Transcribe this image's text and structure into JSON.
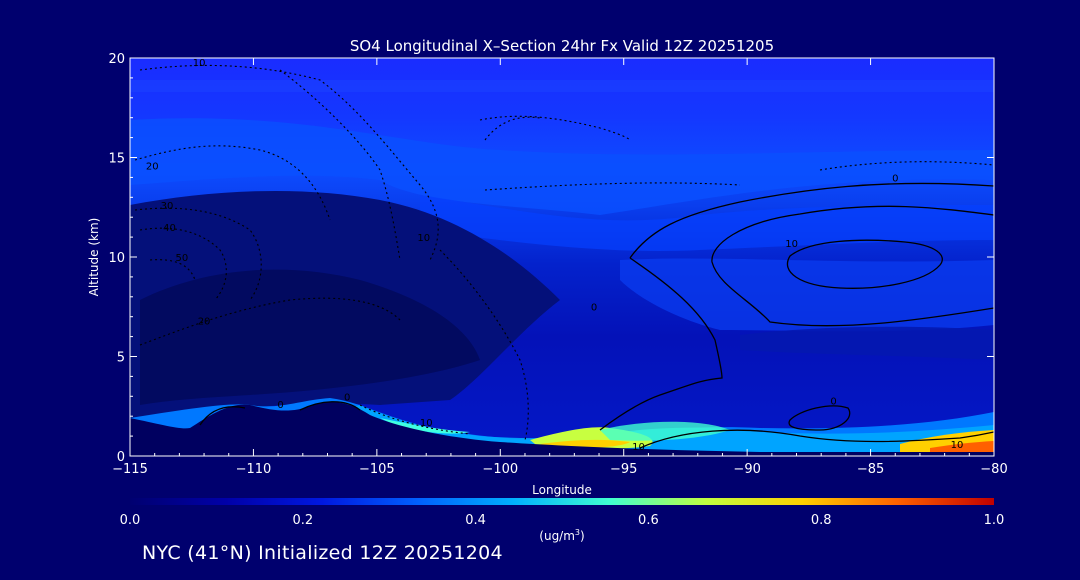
{
  "chart_data": {
    "type": "heatmap",
    "title": "SO4 Longitudinal X–Section 24hr  Fx Valid 12Z 20251205",
    "xlabel": "Longitude",
    "ylabel": "Altitude (km)",
    "xlim": [
      -115,
      -80
    ],
    "ylim": [
      0,
      20
    ],
    "x_ticks": [
      -115,
      -110,
      -105,
      -100,
      -95,
      -90,
      -85,
      -80
    ],
    "x_tick_labels": [
      "−115",
      "−110",
      "−105",
      "−100",
      "−95",
      "−90",
      "−85",
      "−80"
    ],
    "y_ticks": [
      0,
      5,
      10,
      15,
      20
    ],
    "y_tick_labels": [
      "0",
      "5",
      "10",
      "15",
      "20"
    ],
    "colorbar": {
      "min": 0.0,
      "max": 1.0,
      "ticks": [
        0.0,
        0.2,
        0.4,
        0.6,
        0.8,
        1.0
      ],
      "tick_labels": [
        "0.0",
        "0.2",
        "0.4",
        "0.6",
        "0.8",
        "1.0"
      ],
      "unit": "(ug/m",
      "unit_sup": "3",
      "unit_close": ")",
      "colors": [
        "#000070",
        "#0000a8",
        "#0018e0",
        "#0060ff",
        "#00b0ff",
        "#40ffd0",
        "#c0ff40",
        "#ffd000",
        "#ff6000",
        "#c00000"
      ]
    },
    "contour_labels": [
      {
        "text": "10",
        "x": -112.2,
        "y": 19.6
      },
      {
        "text": "20",
        "x": -114.1,
        "y": 14.4
      },
      {
        "text": "30",
        "x": -113.5,
        "y": 12.4
      },
      {
        "text": "40",
        "x": -113.4,
        "y": 11.3
      },
      {
        "text": "50",
        "x": -112.9,
        "y": 9.8
      },
      {
        "text": "20",
        "x": -112.0,
        "y": 6.6
      },
      {
        "text": "10",
        "x": -103.1,
        "y": 10.8
      },
      {
        "text": "0",
        "x": -108.9,
        "y": 2.4
      },
      {
        "text": "0",
        "x": -106.2,
        "y": 2.8
      },
      {
        "text": "10",
        "x": -103.0,
        "y": 1.5
      },
      {
        "text": "0",
        "x": -96.2,
        "y": 7.3
      },
      {
        "text": "0",
        "x": -84.0,
        "y": 13.8
      },
      {
        "text": "10",
        "x": -88.2,
        "y": 10.5
      },
      {
        "text": "0",
        "x": -86.5,
        "y": 2.6
      },
      {
        "text": "10",
        "x": -94.4,
        "y": 0.3
      },
      {
        "text": "10",
        "x": -81.5,
        "y": 0.4
      }
    ]
  },
  "footer_text": "NYC (41°N) Initialized 12Z 20251204",
  "colors": {
    "background": "#00006e",
    "foreground": "#ffffff",
    "contour": "#000000"
  }
}
